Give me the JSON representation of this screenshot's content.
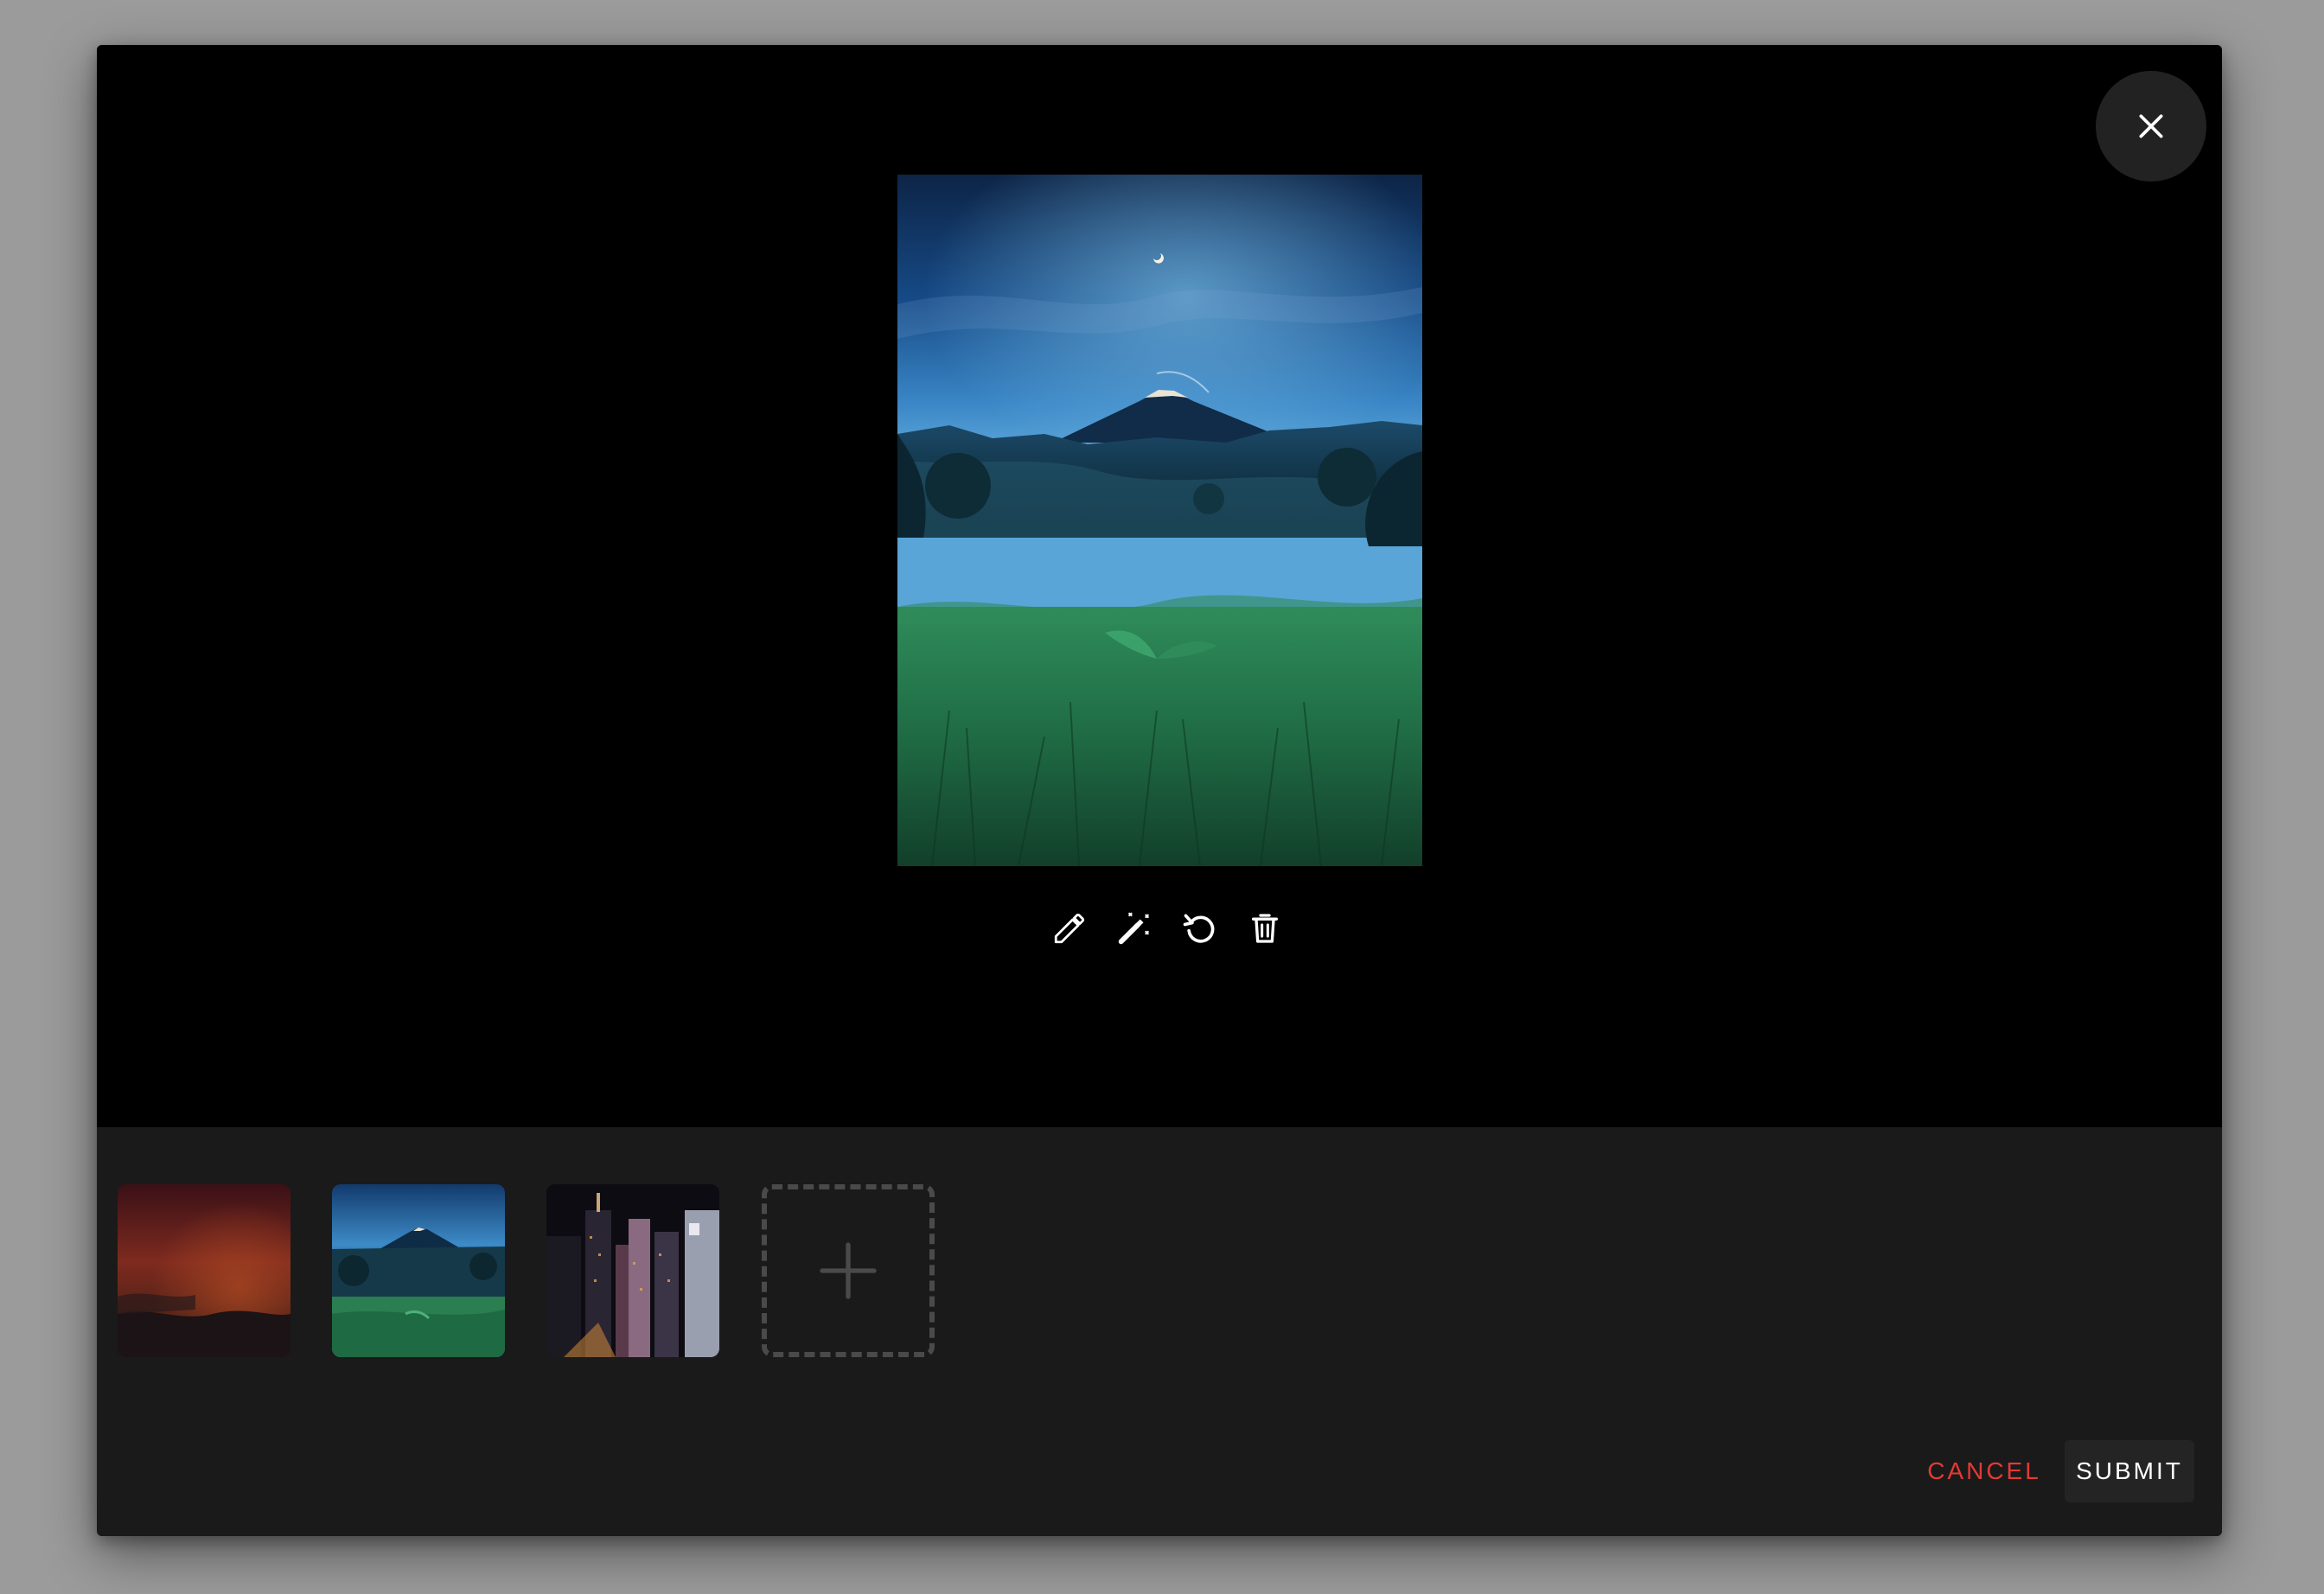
{
  "dialog": {
    "close_icon": "close-icon",
    "main_image": {
      "description_icon": "landscape-volcano-night"
    },
    "toolbar": {
      "tools": [
        {
          "icon": "pencil-icon"
        },
        {
          "icon": "magic-wand-icon"
        },
        {
          "icon": "rotate-icon"
        },
        {
          "icon": "trash-icon"
        }
      ]
    },
    "thumbnails": [
      {
        "icon": "sunset-clouds-thumbnail"
      },
      {
        "icon": "volcano-night-thumbnail"
      },
      {
        "icon": "city-night-thumbnail"
      }
    ],
    "add_icon": "plus-icon",
    "footer": {
      "cancel_label": "CANCEL",
      "submit_label": "SUBMIT"
    }
  },
  "colors": {
    "backdrop": "#9b9b9b",
    "stage": "#000000",
    "panel": "#1a1a1a",
    "cancel": "#e53935",
    "submit_bg": "#242424",
    "dashed_border": "#4a4a4a"
  }
}
